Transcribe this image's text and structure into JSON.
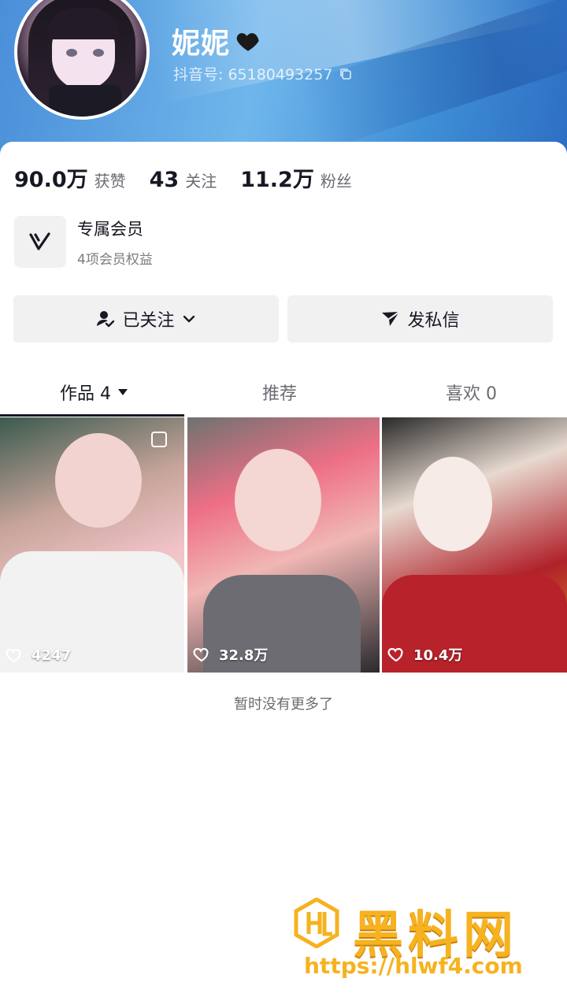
{
  "profile": {
    "nickname": "妮妮",
    "douyin_id_label": "抖音号: 65180493257"
  },
  "stats": [
    {
      "value": "90.0万",
      "label": "获赞"
    },
    {
      "value": "43",
      "label": "关注"
    },
    {
      "value": "11.2万",
      "label": "粉丝"
    }
  ],
  "membership": {
    "title": "专属会员",
    "subtitle": "4项会员权益"
  },
  "actions": {
    "follow_label": "已关注",
    "message_label": "发私信"
  },
  "tabs": [
    {
      "label": "作品 4"
    },
    {
      "label": "推荐"
    },
    {
      "label": "喜欢 0"
    }
  ],
  "works": [
    {
      "likes": "4247"
    },
    {
      "likes": "32.8万"
    },
    {
      "likes": "10.4万"
    }
  ],
  "footer_note": "暂时没有更多了",
  "watermark": {
    "title": "黑料网",
    "url": "https://hlwf4.com"
  },
  "colors": {
    "header_blue": "#4a8fd8",
    "watermark_gold": "#f6b21f"
  },
  "icons": [
    "heart-black-icon",
    "copy-icon",
    "vip-v-icon",
    "followed-user-icon",
    "chevron-down-icon",
    "send-icon",
    "caret-down-icon",
    "pin-icon",
    "heart-outline-icon"
  ]
}
